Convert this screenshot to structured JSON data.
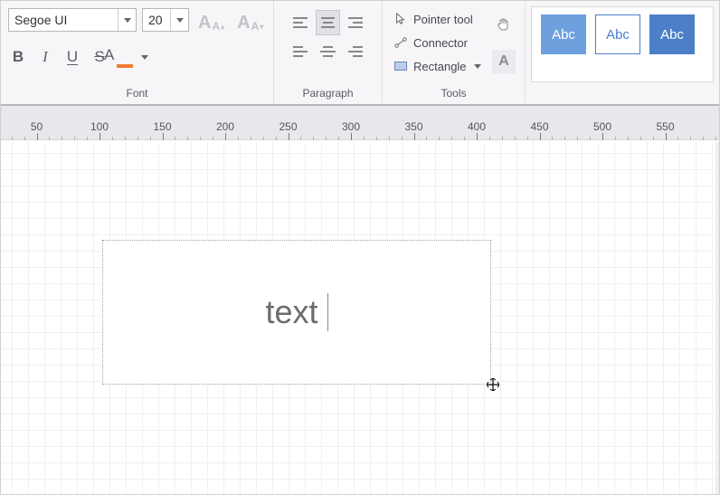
{
  "font": {
    "name": "Segoe UI",
    "size": "20",
    "group_label": "Font",
    "bold": "B",
    "italic": "I",
    "underline": "U",
    "strike": "S",
    "grow_big": "A",
    "grow_small": "A",
    "shrink_big": "A",
    "shrink_small": "A",
    "font_color_glyph": "A"
  },
  "paragraph": {
    "group_label": "Paragraph"
  },
  "tools": {
    "group_label": "Tools",
    "pointer": "Pointer tool",
    "connector": "Connector",
    "rectangle": "Rectangle"
  },
  "styles": {
    "chip_label": "Abc"
  },
  "ruler": {
    "labels": [
      "50",
      "100",
      "150",
      "200",
      "250",
      "300",
      "350",
      "400",
      "450",
      "500",
      "550"
    ]
  },
  "canvas": {
    "shape_text": "text"
  }
}
